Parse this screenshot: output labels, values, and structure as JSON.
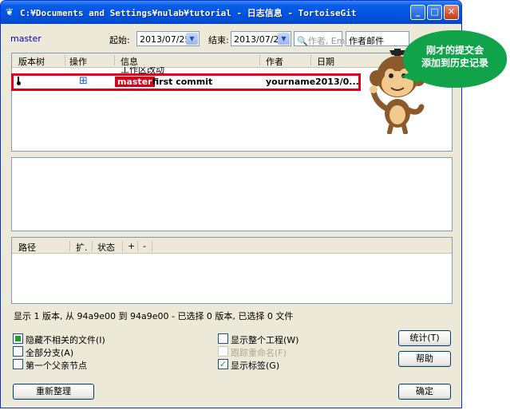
{
  "window": {
    "title": "C:¥Documents and Settings¥nulab¥tutorial - 日志信息 - TortoiseGit",
    "minimize": "_",
    "maximize": "□",
    "close": "✕"
  },
  "filter": {
    "branch": "master",
    "start_label": "起始:",
    "start_date": "2013/07/25",
    "end_label": "结束:",
    "end_date": "2013/07/25",
    "search_placeholder": "作者, Ema",
    "search_type": "作者邮件"
  },
  "log_table": {
    "columns": [
      "版本树",
      "操作",
      "信息",
      "作者",
      "日期"
    ],
    "working_row": {
      "message": "工作区改动"
    },
    "rows": [
      {
        "ref_badge": "master",
        "message": "first commit",
        "author": "yourname",
        "date": "2013/0..."
      }
    ]
  },
  "files_table": {
    "columns": [
      "路径",
      "扩.",
      "状态",
      "+",
      "-"
    ]
  },
  "status_line": "显示 1 版本, 从 94a9e00 到 94a9e00 - 已选择 0 版本, 已选择 0 文件",
  "options": {
    "hide_unrelated": "隐藏不相关的文件(I)",
    "all_branches": "全部分支(A)",
    "first_parent": "第一个父亲节点",
    "show_whole_project": "显示整个工程(W)",
    "follow_renames": "跟踪重命名(F)",
    "show_tags": "显示标签(G)"
  },
  "buttons": {
    "refresh": "重新整理",
    "statistics": "统计(T)",
    "help": "帮助",
    "ok": "确定"
  },
  "callout": {
    "line1": "刚才的提交会",
    "line2": "添加到历史记录"
  },
  "colors": {
    "highlight_border": "#e0001a",
    "badge_bg": "#d0021b",
    "callout_bg": "#11a34a"
  }
}
